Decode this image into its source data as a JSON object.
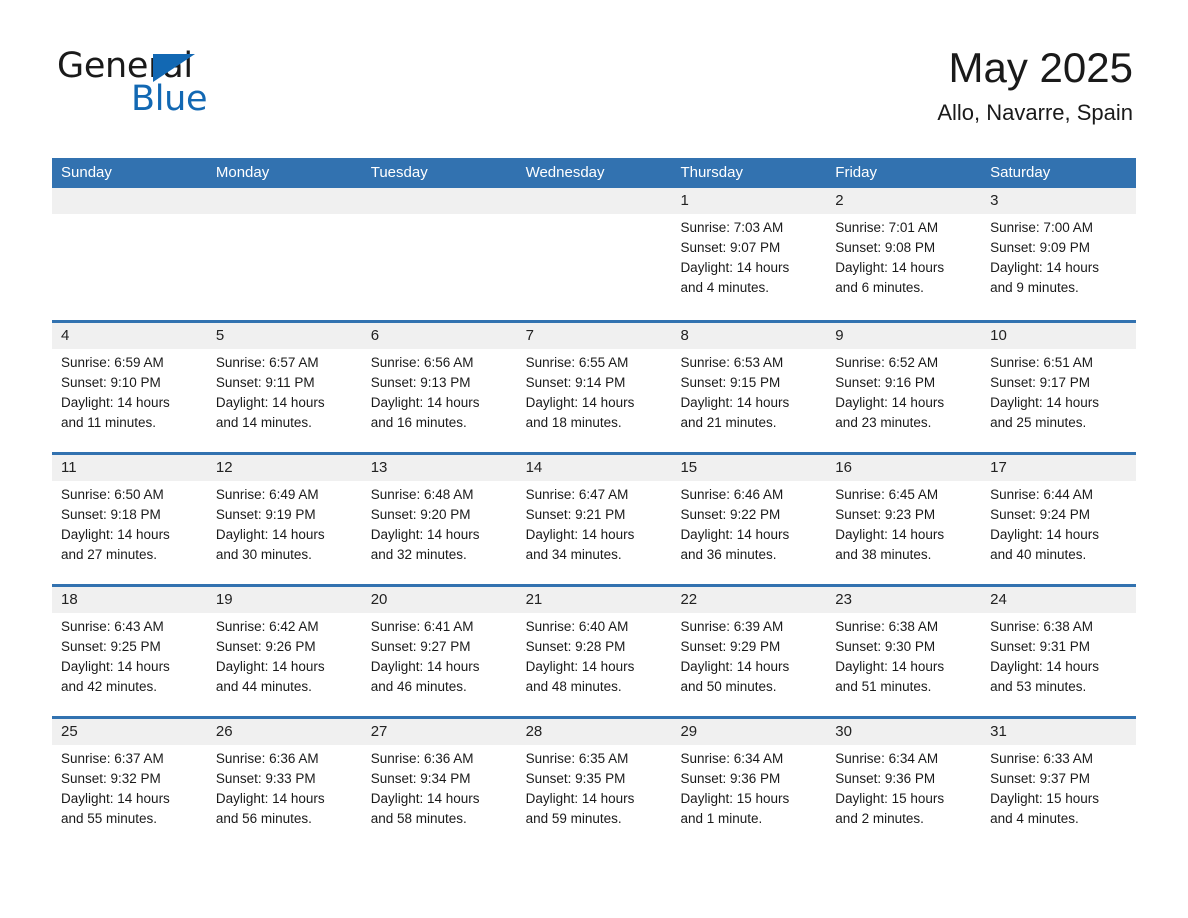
{
  "brand": {
    "name_part1": "General",
    "name_part2": "Blue",
    "accent_color": "#1268b3"
  },
  "header": {
    "title": "May 2025",
    "subtitle": "Allo, Navarre, Spain",
    "header_bg_color": "#3272b0",
    "daynum_band_color": "#f0f0f0"
  },
  "weekdays": [
    "Sunday",
    "Monday",
    "Tuesday",
    "Wednesday",
    "Thursday",
    "Friday",
    "Saturday"
  ],
  "weeks": [
    [
      {
        "day": "",
        "sunrise": "",
        "sunset": "",
        "daylight": "",
        "daylight2": "",
        "empty": true
      },
      {
        "day": "",
        "sunrise": "",
        "sunset": "",
        "daylight": "",
        "daylight2": "",
        "empty": true
      },
      {
        "day": "",
        "sunrise": "",
        "sunset": "",
        "daylight": "",
        "daylight2": "",
        "empty": true
      },
      {
        "day": "",
        "sunrise": "",
        "sunset": "",
        "daylight": "",
        "daylight2": "",
        "empty": true
      },
      {
        "day": "1",
        "sunrise": "Sunrise: 7:03 AM",
        "sunset": "Sunset: 9:07 PM",
        "daylight": "Daylight: 14 hours",
        "daylight2": "and 4 minutes.",
        "empty": false
      },
      {
        "day": "2",
        "sunrise": "Sunrise: 7:01 AM",
        "sunset": "Sunset: 9:08 PM",
        "daylight": "Daylight: 14 hours",
        "daylight2": "and 6 minutes.",
        "empty": false
      },
      {
        "day": "3",
        "sunrise": "Sunrise: 7:00 AM",
        "sunset": "Sunset: 9:09 PM",
        "daylight": "Daylight: 14 hours",
        "daylight2": "and 9 minutes.",
        "empty": false
      }
    ],
    [
      {
        "day": "4",
        "sunrise": "Sunrise: 6:59 AM",
        "sunset": "Sunset: 9:10 PM",
        "daylight": "Daylight: 14 hours",
        "daylight2": "and 11 minutes.",
        "empty": false
      },
      {
        "day": "5",
        "sunrise": "Sunrise: 6:57 AM",
        "sunset": "Sunset: 9:11 PM",
        "daylight": "Daylight: 14 hours",
        "daylight2": "and 14 minutes.",
        "empty": false
      },
      {
        "day": "6",
        "sunrise": "Sunrise: 6:56 AM",
        "sunset": "Sunset: 9:13 PM",
        "daylight": "Daylight: 14 hours",
        "daylight2": "and 16 minutes.",
        "empty": false
      },
      {
        "day": "7",
        "sunrise": "Sunrise: 6:55 AM",
        "sunset": "Sunset: 9:14 PM",
        "daylight": "Daylight: 14 hours",
        "daylight2": "and 18 minutes.",
        "empty": false
      },
      {
        "day": "8",
        "sunrise": "Sunrise: 6:53 AM",
        "sunset": "Sunset: 9:15 PM",
        "daylight": "Daylight: 14 hours",
        "daylight2": "and 21 minutes.",
        "empty": false
      },
      {
        "day": "9",
        "sunrise": "Sunrise: 6:52 AM",
        "sunset": "Sunset: 9:16 PM",
        "daylight": "Daylight: 14 hours",
        "daylight2": "and 23 minutes.",
        "empty": false
      },
      {
        "day": "10",
        "sunrise": "Sunrise: 6:51 AM",
        "sunset": "Sunset: 9:17 PM",
        "daylight": "Daylight: 14 hours",
        "daylight2": "and 25 minutes.",
        "empty": false
      }
    ],
    [
      {
        "day": "11",
        "sunrise": "Sunrise: 6:50 AM",
        "sunset": "Sunset: 9:18 PM",
        "daylight": "Daylight: 14 hours",
        "daylight2": "and 27 minutes.",
        "empty": false
      },
      {
        "day": "12",
        "sunrise": "Sunrise: 6:49 AM",
        "sunset": "Sunset: 9:19 PM",
        "daylight": "Daylight: 14 hours",
        "daylight2": "and 30 minutes.",
        "empty": false
      },
      {
        "day": "13",
        "sunrise": "Sunrise: 6:48 AM",
        "sunset": "Sunset: 9:20 PM",
        "daylight": "Daylight: 14 hours",
        "daylight2": "and 32 minutes.",
        "empty": false
      },
      {
        "day": "14",
        "sunrise": "Sunrise: 6:47 AM",
        "sunset": "Sunset: 9:21 PM",
        "daylight": "Daylight: 14 hours",
        "daylight2": "and 34 minutes.",
        "empty": false
      },
      {
        "day": "15",
        "sunrise": "Sunrise: 6:46 AM",
        "sunset": "Sunset: 9:22 PM",
        "daylight": "Daylight: 14 hours",
        "daylight2": "and 36 minutes.",
        "empty": false
      },
      {
        "day": "16",
        "sunrise": "Sunrise: 6:45 AM",
        "sunset": "Sunset: 9:23 PM",
        "daylight": "Daylight: 14 hours",
        "daylight2": "and 38 minutes.",
        "empty": false
      },
      {
        "day": "17",
        "sunrise": "Sunrise: 6:44 AM",
        "sunset": "Sunset: 9:24 PM",
        "daylight": "Daylight: 14 hours",
        "daylight2": "and 40 minutes.",
        "empty": false
      }
    ],
    [
      {
        "day": "18",
        "sunrise": "Sunrise: 6:43 AM",
        "sunset": "Sunset: 9:25 PM",
        "daylight": "Daylight: 14 hours",
        "daylight2": "and 42 minutes.",
        "empty": false
      },
      {
        "day": "19",
        "sunrise": "Sunrise: 6:42 AM",
        "sunset": "Sunset: 9:26 PM",
        "daylight": "Daylight: 14 hours",
        "daylight2": "and 44 minutes.",
        "empty": false
      },
      {
        "day": "20",
        "sunrise": "Sunrise: 6:41 AM",
        "sunset": "Sunset: 9:27 PM",
        "daylight": "Daylight: 14 hours",
        "daylight2": "and 46 minutes.",
        "empty": false
      },
      {
        "day": "21",
        "sunrise": "Sunrise: 6:40 AM",
        "sunset": "Sunset: 9:28 PM",
        "daylight": "Daylight: 14 hours",
        "daylight2": "and 48 minutes.",
        "empty": false
      },
      {
        "day": "22",
        "sunrise": "Sunrise: 6:39 AM",
        "sunset": "Sunset: 9:29 PM",
        "daylight": "Daylight: 14 hours",
        "daylight2": "and 50 minutes.",
        "empty": false
      },
      {
        "day": "23",
        "sunrise": "Sunrise: 6:38 AM",
        "sunset": "Sunset: 9:30 PM",
        "daylight": "Daylight: 14 hours",
        "daylight2": "and 51 minutes.",
        "empty": false
      },
      {
        "day": "24",
        "sunrise": "Sunrise: 6:38 AM",
        "sunset": "Sunset: 9:31 PM",
        "daylight": "Daylight: 14 hours",
        "daylight2": "and 53 minutes.",
        "empty": false
      }
    ],
    [
      {
        "day": "25",
        "sunrise": "Sunrise: 6:37 AM",
        "sunset": "Sunset: 9:32 PM",
        "daylight": "Daylight: 14 hours",
        "daylight2": "and 55 minutes.",
        "empty": false
      },
      {
        "day": "26",
        "sunrise": "Sunrise: 6:36 AM",
        "sunset": "Sunset: 9:33 PM",
        "daylight": "Daylight: 14 hours",
        "daylight2": "and 56 minutes.",
        "empty": false
      },
      {
        "day": "27",
        "sunrise": "Sunrise: 6:36 AM",
        "sunset": "Sunset: 9:34 PM",
        "daylight": "Daylight: 14 hours",
        "daylight2": "and 58 minutes.",
        "empty": false
      },
      {
        "day": "28",
        "sunrise": "Sunrise: 6:35 AM",
        "sunset": "Sunset: 9:35 PM",
        "daylight": "Daylight: 14 hours",
        "daylight2": "and 59 minutes.",
        "empty": false
      },
      {
        "day": "29",
        "sunrise": "Sunrise: 6:34 AM",
        "sunset": "Sunset: 9:36 PM",
        "daylight": "Daylight: 15 hours",
        "daylight2": "and 1 minute.",
        "empty": false
      },
      {
        "day": "30",
        "sunrise": "Sunrise: 6:34 AM",
        "sunset": "Sunset: 9:36 PM",
        "daylight": "Daylight: 15 hours",
        "daylight2": "and 2 minutes.",
        "empty": false
      },
      {
        "day": "31",
        "sunrise": "Sunrise: 6:33 AM",
        "sunset": "Sunset: 9:37 PM",
        "daylight": "Daylight: 15 hours",
        "daylight2": "and 4 minutes.",
        "empty": false
      }
    ]
  ]
}
